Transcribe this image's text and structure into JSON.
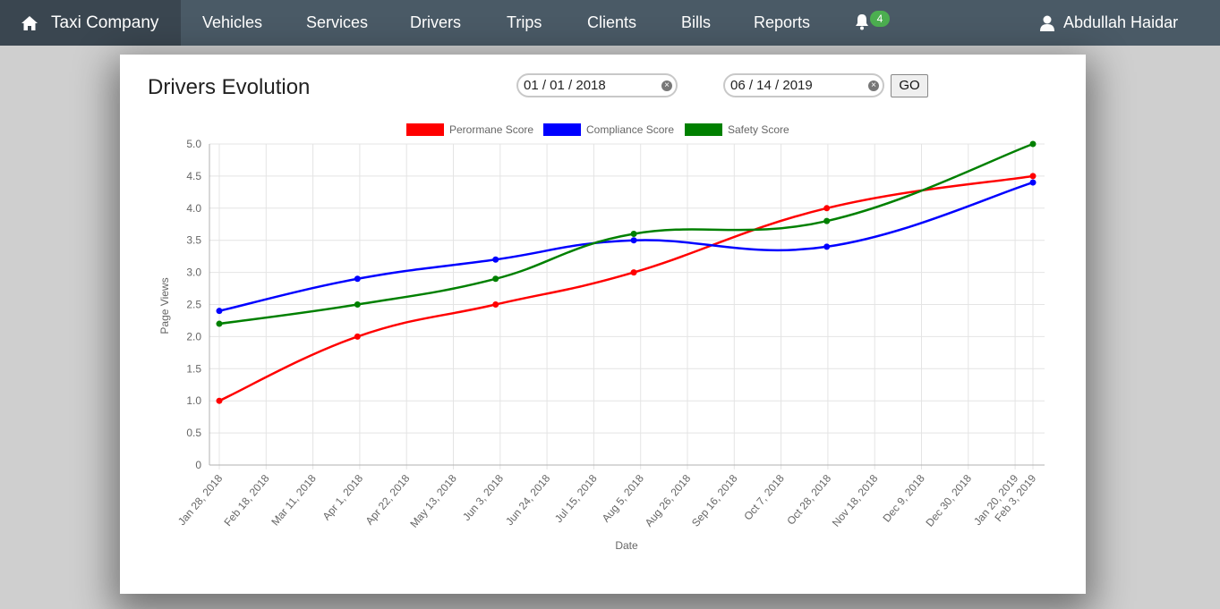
{
  "nav": {
    "brand": "Taxi Company",
    "items": [
      "Vehicles",
      "Services",
      "Drivers",
      "Trips",
      "Clients",
      "Bills",
      "Reports"
    ],
    "notification_count": "4",
    "user_name": "Abdullah Haidar"
  },
  "page": {
    "title": "Drivers Evolution",
    "date_from": "01 / 01 / 2018",
    "date_to": "06 / 14 / 2019",
    "go_label": "GO"
  },
  "chart_data": {
    "type": "line",
    "title": "",
    "xlabel": "Date",
    "ylabel": "Page Views",
    "ylim": [
      0,
      5
    ],
    "y_ticks": [
      "0",
      "0.5",
      "1.0",
      "1.5",
      "2.0",
      "2.5",
      "3.0",
      "3.5",
      "4.0",
      "4.5",
      "5.0"
    ],
    "x_tick_labels": [
      "Jan 28, 2018",
      "Feb 18, 2018",
      "Mar 11, 2018",
      "Apr 1, 2018",
      "Apr 22, 2018",
      "May 13, 2018",
      "Jun 3, 2018",
      "Jun 24, 2018",
      "Jul 15, 2018",
      "Aug 5, 2018",
      "Aug 26, 2018",
      "Sep 16, 2018",
      "Oct 7, 2018",
      "Oct 28, 2018",
      "Nov 18, 2018",
      "Dec 9, 2018",
      "Dec 30, 2018",
      "Jan 20, 2019",
      "Feb 3, 2019"
    ],
    "grid": true,
    "legend_position": "top",
    "x_dates": [
      "2018-01-28",
      "2018-04-01",
      "2018-06-03",
      "2018-08-05",
      "2018-11-01",
      "2019-02-03"
    ],
    "series": [
      {
        "name": "Perormane Score",
        "color": "#ff0000",
        "values": [
          1.0,
          2.0,
          2.5,
          3.0,
          4.0,
          4.5
        ]
      },
      {
        "name": "Compliance Score",
        "color": "#0000ff",
        "values": [
          2.4,
          2.9,
          3.2,
          3.5,
          3.4,
          4.4
        ]
      },
      {
        "name": "Safety Score",
        "color": "#008000",
        "values": [
          2.2,
          2.5,
          2.9,
          3.6,
          3.8,
          5.0
        ]
      }
    ]
  }
}
